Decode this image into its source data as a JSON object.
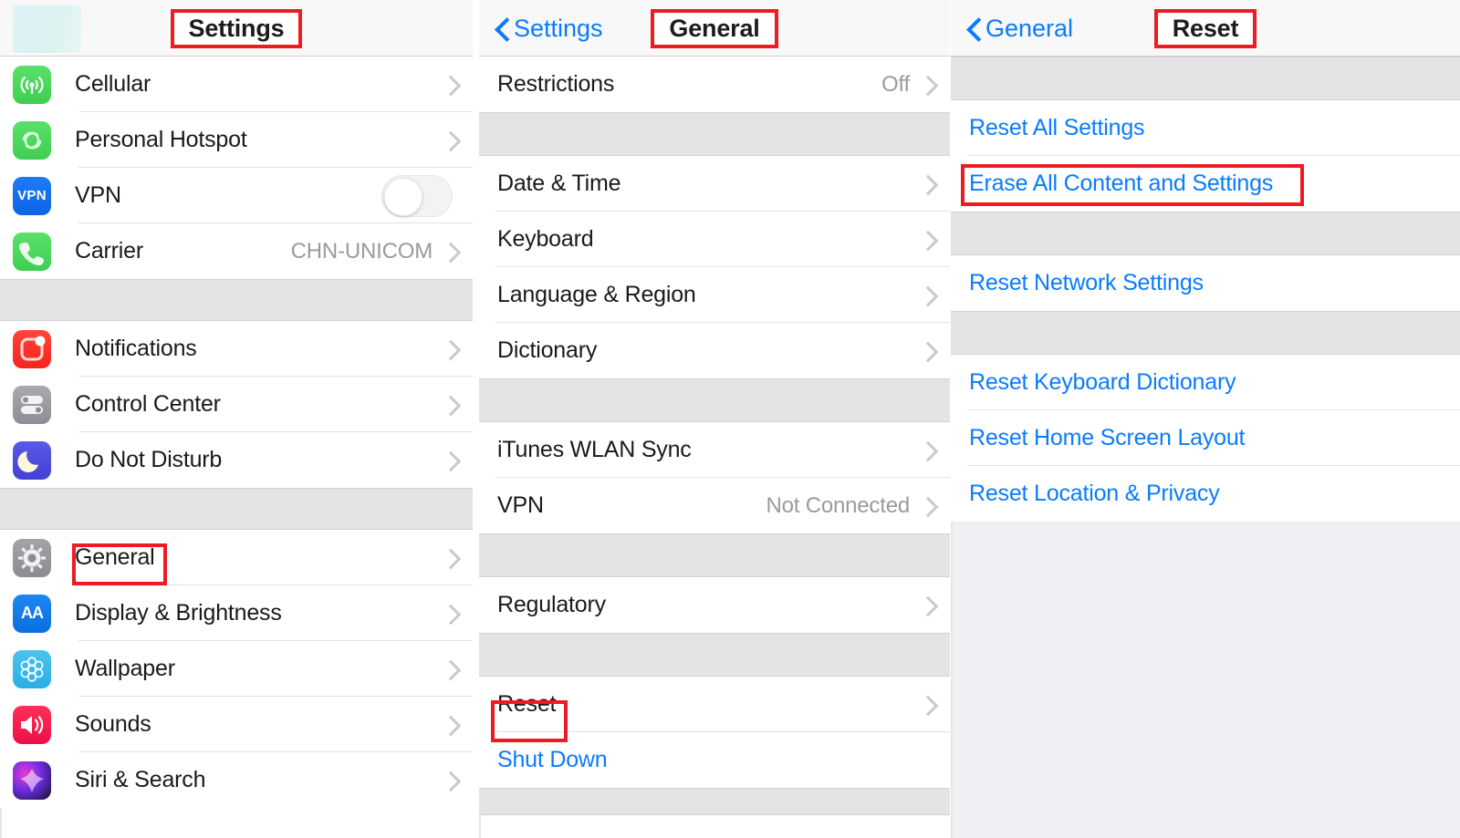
{
  "theme": {
    "accent_blue": "#0a7bff",
    "annotation_red": "#ee1c22",
    "group_gap_gray": "#e4e4e6",
    "value_gray": "#9b9b9f"
  },
  "panels": {
    "settings": {
      "nav": {
        "title": "Settings",
        "title_highlighted": true,
        "back_label": ""
      },
      "groups": [
        {
          "rows": [
            {
              "label": "Cellular",
              "icon": "cellular-icon",
              "accessory": "chevron"
            },
            {
              "label": "Personal Hotspot",
              "icon": "hotspot-icon",
              "accessory": "chevron"
            },
            {
              "label": "VPN",
              "icon": "vpn-icon",
              "accessory": "toggle",
              "toggle_on": false
            },
            {
              "label": "Carrier",
              "icon": "carrier-icon",
              "accessory": "chevron",
              "value": "CHN-UNICOM"
            }
          ]
        },
        {
          "rows": [
            {
              "label": "Notifications",
              "icon": "notifications-icon",
              "accessory": "chevron"
            },
            {
              "label": "Control Center",
              "icon": "control-center-icon",
              "accessory": "chevron"
            },
            {
              "label": "Do Not Disturb",
              "icon": "do-not-disturb-icon",
              "accessory": "chevron"
            }
          ]
        },
        {
          "rows": [
            {
              "label": "General",
              "icon": "general-gear-icon",
              "accessory": "chevron",
              "highlighted": true
            },
            {
              "label": "Display & Brightness",
              "icon": "display-icon",
              "accessory": "chevron"
            },
            {
              "label": "Wallpaper",
              "icon": "wallpaper-icon",
              "accessory": "chevron"
            },
            {
              "label": "Sounds",
              "icon": "sounds-icon",
              "accessory": "chevron"
            },
            {
              "label": "Siri & Search",
              "icon": "siri-icon",
              "accessory": "chevron"
            }
          ]
        }
      ]
    },
    "general": {
      "nav": {
        "title": "General",
        "title_highlighted": true,
        "back_label": "Settings"
      },
      "groups": [
        {
          "rows": [
            {
              "label": "Restrictions",
              "value": "Off",
              "accessory": "chevron"
            }
          ]
        },
        {
          "rows": [
            {
              "label": "Date & Time",
              "accessory": "chevron"
            },
            {
              "label": "Keyboard",
              "accessory": "chevron"
            },
            {
              "label": "Language & Region",
              "accessory": "chevron"
            },
            {
              "label": "Dictionary",
              "accessory": "chevron"
            }
          ]
        },
        {
          "rows": [
            {
              "label": "iTunes WLAN Sync",
              "accessory": "chevron"
            },
            {
              "label": "VPN",
              "value": "Not Connected",
              "accessory": "chevron"
            }
          ]
        },
        {
          "rows": [
            {
              "label": "Regulatory",
              "accessory": "chevron"
            }
          ]
        },
        {
          "rows": [
            {
              "label": "Reset",
              "accessory": "chevron",
              "highlighted": true
            },
            {
              "label": "Shut Down",
              "style": "blue",
              "accessory": "none"
            }
          ]
        }
      ]
    },
    "reset": {
      "nav": {
        "title": "Reset",
        "title_highlighted": true,
        "back_label": "General"
      },
      "groups": [
        {
          "rows": [
            {
              "label": "Reset All Settings",
              "style": "blue",
              "accessory": "none"
            },
            {
              "label": "Erase All Content and Settings",
              "style": "blue",
              "accessory": "none",
              "highlighted": true
            }
          ]
        },
        {
          "rows": [
            {
              "label": "Reset Network Settings",
              "style": "blue",
              "accessory": "none"
            }
          ]
        },
        {
          "rows": [
            {
              "label": "Reset Keyboard Dictionary",
              "style": "blue",
              "accessory": "none"
            },
            {
              "label": "Reset Home Screen Layout",
              "style": "blue",
              "accessory": "none"
            },
            {
              "label": "Reset Location & Privacy",
              "style": "blue",
              "accessory": "none"
            }
          ]
        }
      ]
    }
  }
}
